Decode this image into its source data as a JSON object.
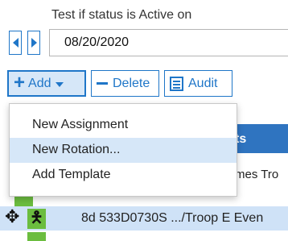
{
  "filter": {
    "status_label": "Test if status is Active on",
    "date_value": "08/20/2020"
  },
  "toolbar": {
    "add_label": "Add",
    "delete_label": "Delete",
    "audit_label": "Audit"
  },
  "add_menu": {
    "items": [
      {
        "label": "New Assignment"
      },
      {
        "label": "New Rotation...",
        "highlighted": true
      },
      {
        "label": "Add Template"
      }
    ]
  },
  "grid": {
    "header_partial": "ts",
    "row1_partial": "mes Tro",
    "selected_row_text": "8d 533D0730S .../Troop E Even"
  },
  "colors": {
    "accent": "#1f76c8",
    "header_bg": "#2f74c0",
    "highlight": "#d6e7f8",
    "status_green": "#6bbd3f"
  }
}
